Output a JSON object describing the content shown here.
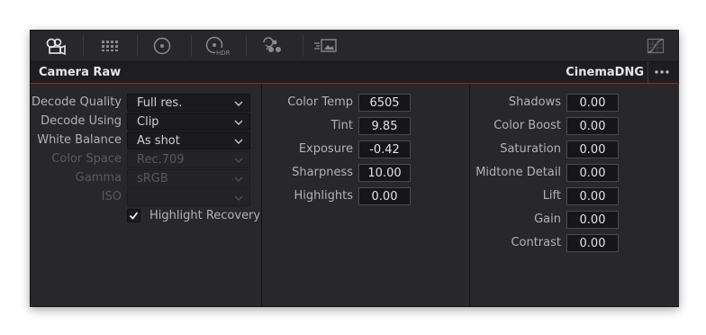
{
  "toolbar": {
    "icons": [
      "camera-raw-icon",
      "color-match-icon",
      "primaries-wheel-icon",
      "hdr-wheel-icon",
      "rgb-mixer-icon",
      "motion-effects-icon",
      "curves-icon"
    ],
    "hdr_label": "HDR"
  },
  "header": {
    "title": "Camera Raw",
    "codec": "CinemaDNG"
  },
  "decode": {
    "rows": [
      {
        "label": "Decode Quality",
        "value": "Full res.",
        "enabled": true
      },
      {
        "label": "Decode Using",
        "value": "Clip",
        "enabled": true
      },
      {
        "label": "White Balance",
        "value": "As shot",
        "enabled": true
      },
      {
        "label": "Color Space",
        "value": "Rec.709",
        "enabled": false
      },
      {
        "label": "Gamma",
        "value": "sRGB",
        "enabled": false
      },
      {
        "label": "ISO",
        "value": "",
        "enabled": false
      }
    ],
    "highlight_recovery": {
      "label": "Highlight Recovery",
      "checked": true
    }
  },
  "adjust": {
    "rows": [
      {
        "label": "Color Temp",
        "value": "6505"
      },
      {
        "label": "Tint",
        "value": "9.85"
      },
      {
        "label": "Exposure",
        "value": "-0.42"
      },
      {
        "label": "Sharpness",
        "value": "10.00"
      },
      {
        "label": "Highlights",
        "value": "0.00"
      }
    ]
  },
  "tone": {
    "rows": [
      {
        "label": "Shadows",
        "value": "0.00"
      },
      {
        "label": "Color Boost",
        "value": "0.00"
      },
      {
        "label": "Saturation",
        "value": "0.00"
      },
      {
        "label": "Midtone Detail",
        "value": "0.00"
      },
      {
        "label": "Lift",
        "value": "0.00"
      },
      {
        "label": "Gain",
        "value": "0.00"
      },
      {
        "label": "Contrast",
        "value": "0.00"
      }
    ]
  }
}
